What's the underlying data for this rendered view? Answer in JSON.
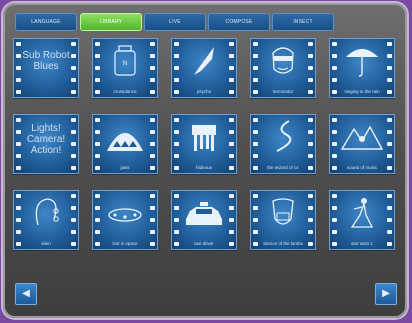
{
  "tabs": [
    {
      "label": "LANGUAGE",
      "active": false
    },
    {
      "label": "LIBRARY",
      "active": true
    },
    {
      "label": "LIVE",
      "active": false
    },
    {
      "label": "COMPOSE",
      "active": false
    },
    {
      "label": "INSECT",
      "active": false
    }
  ],
  "tiles": [
    {
      "text": "Sub Robot Blues",
      "caption": "",
      "icon": "text-only"
    },
    {
      "text": "",
      "caption": "crossdance",
      "icon": "bottle-icon"
    },
    {
      "text": "",
      "caption": "psycho",
      "icon": "knife-icon"
    },
    {
      "text": "",
      "caption": "terminator",
      "icon": "terminator-face-icon"
    },
    {
      "text": "",
      "caption": "singing in the rain",
      "icon": "umbrella-icon"
    },
    {
      "text": "Lights! Camera! Action!",
      "caption": "",
      "icon": "text-only"
    },
    {
      "text": "",
      "caption": "jaws",
      "icon": "shark-icon"
    },
    {
      "text": "",
      "caption": "hideous",
      "icon": "walker-robot-icon"
    },
    {
      "text": "",
      "caption": "the wizard of oz",
      "icon": "road-icon"
    },
    {
      "text": "",
      "caption": "sound of music",
      "icon": "mountains-icon"
    },
    {
      "text": "",
      "caption": "alien",
      "icon": "alien-head-icon"
    },
    {
      "text": "",
      "caption": "lost in space",
      "icon": "ufo-icon"
    },
    {
      "text": "",
      "caption": "taxi driver",
      "icon": "taxi-icon"
    },
    {
      "text": "",
      "caption": "silence of the lambs",
      "icon": "mask-face-icon"
    },
    {
      "text": "",
      "caption": "star wars 1",
      "icon": "dancer-icon"
    }
  ],
  "nav": {
    "prev": "◀",
    "next": "▶"
  },
  "colors": {
    "tab_active": "#6fcf3f",
    "tab": "#1f5a96",
    "tile": "#2a6fb0",
    "frame": "#505050",
    "border": "#7a4aa0"
  }
}
